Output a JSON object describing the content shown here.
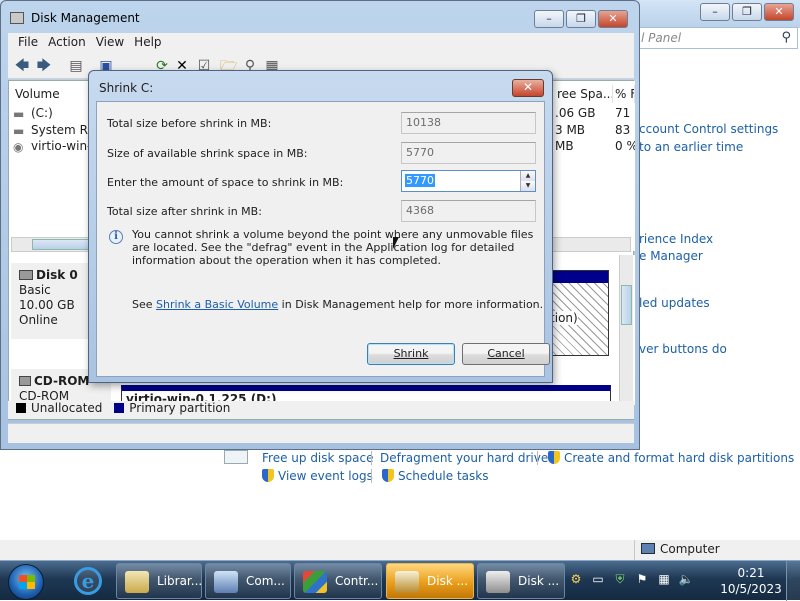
{
  "control_panel": {
    "search_placeholder": "l Panel",
    "links": [
      "ccount Control settings",
      "to an earlier time",
      "rience Index",
      "e Manager",
      "led updates",
      "ver buttons do"
    ],
    "tasks_row1": [
      "Free up disk space",
      "Defragment your hard drive",
      "Create and format hard disk partitions"
    ],
    "tasks_row2": [
      "View event logs",
      "Schedule tasks"
    ],
    "status_computer": "Computer"
  },
  "disk_mgmt": {
    "title": "Disk Management",
    "menu": [
      "File",
      "Action",
      "View",
      "Help"
    ],
    "columns": {
      "volume": "Volume",
      "free_space": "ree Spa...",
      "pct_free": "% F"
    },
    "volumes": [
      {
        "name": "(C:)",
        "free": ".06 GB",
        "pct": "71"
      },
      {
        "name": "System Res",
        "free": "3 MB",
        "pct": "83"
      },
      {
        "name": "virtio-win-0",
        "free": "MB",
        "pct": "0 %"
      }
    ],
    "disk0": {
      "name": "Disk 0",
      "type": "Basic",
      "size": "10.00 GB",
      "status": "Online",
      "partition_fragment": "tition)"
    },
    "cdrom": {
      "name": "CD-ROM",
      "label": "CD-ROM",
      "volume": "virtio-win-0.1.225  (D:)"
    },
    "legend": {
      "unallocated": "Unallocated",
      "primary": "Primary partition",
      "unallocated_color": "#000000",
      "primary_color": "#00008b"
    }
  },
  "dialog": {
    "title": "Shrink C:",
    "fields": {
      "total_before_label": "Total size before shrink in MB:",
      "total_before_value": "10138",
      "available_label": "Size of available shrink space in MB:",
      "available_value": "5770",
      "amount_label": "Enter the amount of space to shrink in MB:",
      "amount_value": "5770",
      "total_after_label": "Total size after shrink in MB:",
      "total_after_value": "4368"
    },
    "info": "You cannot shrink a volume beyond the point where any unmovable files are located. See the \"defrag\" event in the Application log for detailed information about the operation when it has completed.",
    "see_prefix": "See",
    "see_link": "Shrink a Basic Volume",
    "see_suffix": "in Disk Management help for more information.",
    "shrink_button": "Shrink",
    "cancel_button": "Cancel"
  },
  "taskbar": {
    "tasks": [
      "Librar...",
      "Com...",
      "Contr...",
      "Disk ...",
      "Disk ..."
    ],
    "time": "0:21",
    "date": "10/5/2023"
  }
}
